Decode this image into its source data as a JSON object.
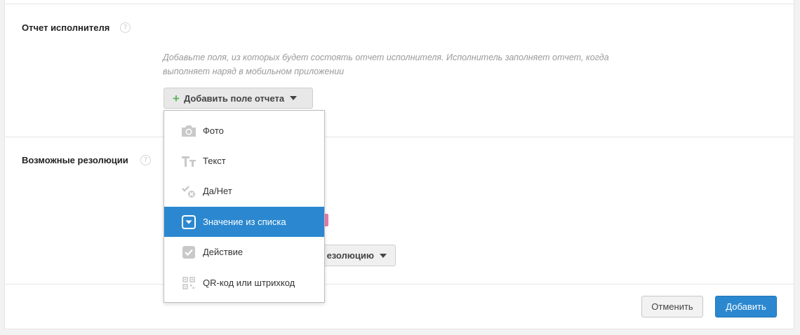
{
  "report_section": {
    "title": "Отчет исполнителя",
    "help": "?",
    "hint": "Добавьте поля, из которых будет состоять отчет исполнителя. Исполнитель заполняет отчет, когда выполняет наряд в мобильном приложении",
    "add_field_button": "Добавить поле отчета"
  },
  "resolutions_section": {
    "title": "Возможные резолюции",
    "help": "?",
    "add_resolution_partial": "езолюцию"
  },
  "dropdown": {
    "items": [
      {
        "label": "Фото",
        "icon": "camera-icon"
      },
      {
        "label": "Текст",
        "icon": "text-icon"
      },
      {
        "label": "Да/Нет",
        "icon": "yes-no-icon"
      },
      {
        "label": "Значение из списка",
        "icon": "list-select-icon",
        "selected": true
      },
      {
        "label": "Действие",
        "icon": "checkbox-icon"
      },
      {
        "label": "QR-код или штрихкод",
        "icon": "qr-code-icon"
      }
    ]
  },
  "footer": {
    "cancel": "Отменить",
    "submit": "Добавить"
  },
  "colors": {
    "accent": "#2b88d0",
    "plus_green": "#5bb75b",
    "tag_pink": "#e87aa8"
  }
}
